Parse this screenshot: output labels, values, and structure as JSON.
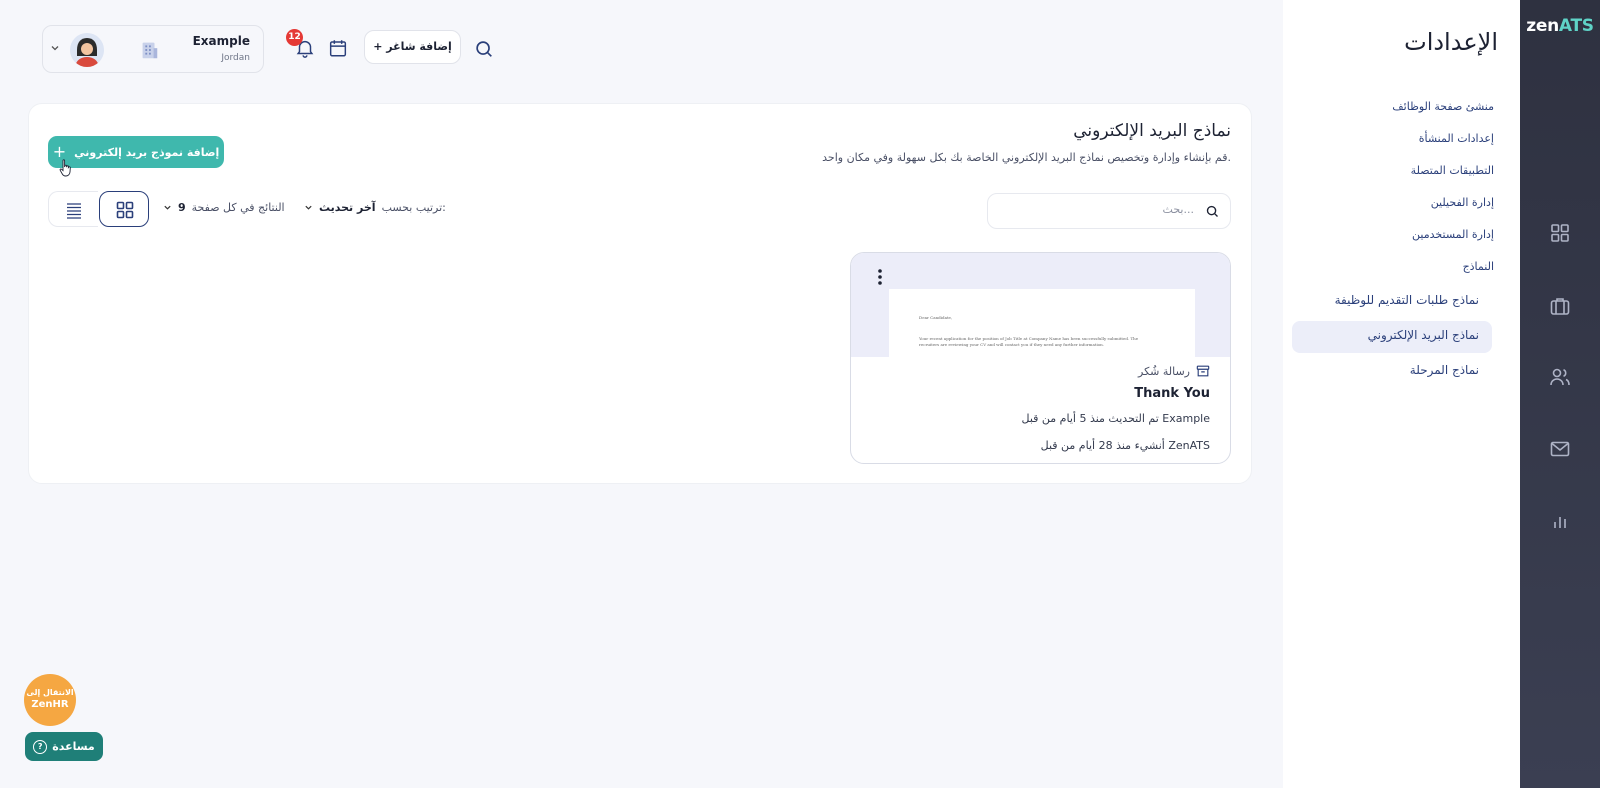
{
  "brand": {
    "logo_left": "zen",
    "logo_right": "ATS"
  },
  "sidebar": {
    "title": "الإعدادات",
    "items": [
      {
        "label": "منشئ صفحة الوظائف"
      },
      {
        "label": "إعدادات المنشأة"
      },
      {
        "label": "التطبيقات المتصلة"
      },
      {
        "label": "إدارة الفحيلين"
      },
      {
        "label": "إدارة المستخدمين"
      },
      {
        "label": "النماذج"
      }
    ],
    "sub_items": [
      {
        "label": "نماذج طلبات التقديم للوظيفة"
      },
      {
        "label": "نماذج البريد الإلكتروني"
      },
      {
        "label": "نماذج المرحلة"
      }
    ]
  },
  "topbar": {
    "account_name": "Example",
    "account_location": "Jordan",
    "notifications_count": "12",
    "add_talent_label": "+ إضافة شاغر"
  },
  "main": {
    "title": "نماذج البريد الإلكتروني",
    "description": "قم بإنشاء وإدارة وتخصيص نماذج البريد الإلكتروني الخاصة بك بكل سهولة وفي مكان واحد.",
    "add_button_label": "إضافة نموذج بريد إلكتروني",
    "search_placeholder": "بحث...",
    "sort_label": "ترتيب بحسب:",
    "sort_value": "آخر تحديث",
    "per_page_label": "النتائج في كل صفحة",
    "per_page_value": "9"
  },
  "templates": [
    {
      "type": "رسالة شُكر",
      "name": "Thank You",
      "updated": "تم التحديث منذ 5 أيام من قبل Example",
      "created": "أنشيء منذ 28 أيام من قبل ZenATS",
      "preview_line1": "Dear Candidate,",
      "preview_line2": "Your recent application for the position of Job Title at Company Name has been successfully submitted. The recruiters are reviewing your CV and will contact you if they need any further information."
    }
  ],
  "floating": {
    "zenhr_line1": "الانتقال إلى",
    "zenhr_line2": "ZenHR",
    "help_label": "مساعدة",
    "help_icon": "?"
  },
  "colors": {
    "accent": "#3fb8ad",
    "navy": "#2a3f7a",
    "rail": "#2e3140",
    "badge": "#e53935",
    "zenhr": "#f5a742",
    "help": "#1f7f78"
  }
}
